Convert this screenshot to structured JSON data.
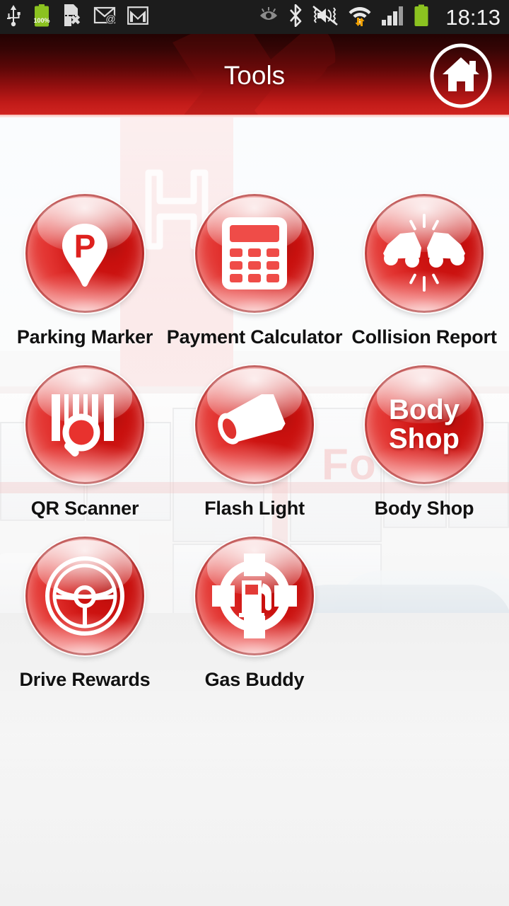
{
  "statusbar": {
    "time": "18:13",
    "battery_percent": "100%",
    "left_icons": [
      "usb-icon",
      "battery-percent-icon",
      "sim-card-error-icon",
      "email-icon",
      "gmail-icon"
    ],
    "right_icons": [
      "smart-stay-eye-icon",
      "bluetooth-icon",
      "mute-vibrate-icon",
      "wifi-transfer-icon",
      "signal-bars-icon",
      "battery-icon"
    ],
    "background_color": "#1c1c1c",
    "text_color": "#f2f2f2",
    "battery_color": "#8bc220"
  },
  "header": {
    "title": "Tools",
    "home_button_label": "home-button",
    "gradient_top": "#230202",
    "gradient_bottom": "#d02420",
    "watermark": "wrench-tools-watermark"
  },
  "background": {
    "description": "faded Honda dealership storefront photo",
    "sign_text": "Fo",
    "logo": "honda-h-logo"
  },
  "grid": {
    "rows": [
      [
        {
          "label": "Parking Marker",
          "icon": "parking-marker-icon",
          "name": "parking-marker"
        },
        {
          "label": "Payment Calculator",
          "icon": "calculator-icon",
          "name": "payment-calculator"
        },
        {
          "label": "Collision Report",
          "icon": "collision-icon",
          "name": "collision-report"
        }
      ],
      [
        {
          "label": "QR Scanner",
          "icon": "barcode-scanner-icon",
          "name": "qr-scanner"
        },
        {
          "label": "Flash Light",
          "icon": "flashlight-icon",
          "name": "flash-light"
        },
        {
          "label": "Body Shop",
          "icon": "text-icon",
          "name": "body-shop",
          "icon_text_line1": "Body",
          "icon_text_line2": "Shop"
        }
      ],
      [
        {
          "label": "Drive Rewards",
          "icon": "steering-wheel-icon",
          "name": "drive-rewards"
        },
        {
          "label": "Gas Buddy",
          "icon": "gas-pump-target-icon",
          "name": "gas-buddy"
        },
        {
          "label": "",
          "icon": "",
          "name": "empty"
        }
      ]
    ]
  },
  "colors": {
    "accent_red": "#d4110f",
    "header_dark": "#230202",
    "caption_text": "#111111"
  }
}
